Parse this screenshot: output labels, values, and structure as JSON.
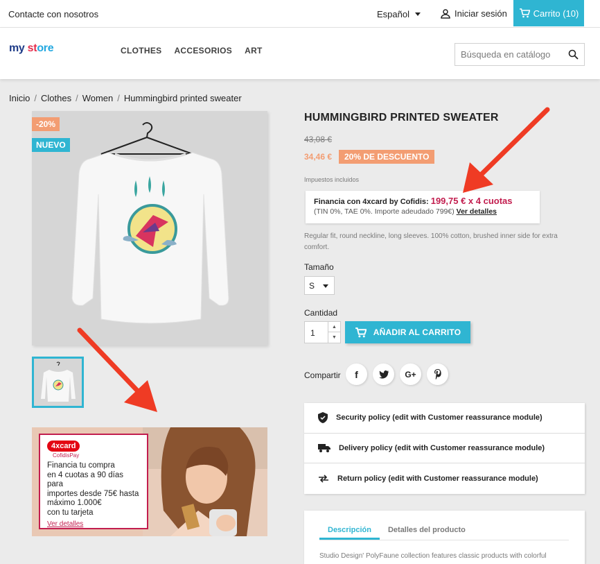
{
  "topbar": {
    "contact": "Contacte con nosotros",
    "language": "Español",
    "signin": "Iniciar sesión",
    "cart": "Carrito (10)"
  },
  "header": {
    "logo": {
      "part1": "my",
      "part2": " st",
      "part3": "ore"
    },
    "menu": [
      "CLOTHES",
      "ACCESORIOS",
      "ART"
    ],
    "search_placeholder": "Búsqueda en catálogo"
  },
  "breadcrumb": [
    "Inicio",
    "Clothes",
    "Women",
    "Hummingbird printed sweater"
  ],
  "product": {
    "flags": {
      "discount": "-20%",
      "new": "NUEVO"
    },
    "title": "HUMMINGBIRD PRINTED SWEATER",
    "old_price": "43,08 €",
    "price": "34,46 €",
    "discount_label": "20% DE DESCUENTO",
    "tax": "Impuestos incluidos",
    "financing": {
      "prefix": "Financia con 4xcard by Cofidis: ",
      "amount": "199,75 € x 4 cuotas",
      "detail": "(TIN 0%, TAE 0%. Importe adeudado 799€) ",
      "link": "Ver detalles"
    },
    "description": "Regular fit, round neckline, long sleeves. 100% cotton, brushed inner side for extra comfort.",
    "size_label": "Tamaño",
    "size_value": "S",
    "quantity_label": "Cantidad",
    "quantity_value": "1",
    "add_to_cart": "AÑADIR AL CARRITO",
    "share_label": "Compartir"
  },
  "banner": {
    "badge": "4xcard",
    "brand": "CofidisPay",
    "text_lines": [
      "Financia tu compra",
      "en 4 cuotas a 90 días para",
      "importes desde 75€ hasta",
      "máximo 1.000€",
      "con tu tarjeta"
    ],
    "link": "Ver detalles"
  },
  "reassurance": [
    {
      "icon": "shield-icon",
      "label": "Security policy (edit with Customer reassurance module)"
    },
    {
      "icon": "truck-icon",
      "label": "Delivery policy (edit with Customer reassurance module)"
    },
    {
      "icon": "swap-arrows-icon",
      "label": "Return policy (edit with Customer reassurance module)"
    }
  ],
  "tabs": {
    "items": [
      "Descripción",
      "Detalles del producto"
    ],
    "text": "Studio Design' PolyFaune collection features classic products with colorful"
  },
  "colors": {
    "accent": "#2fb5d2",
    "discount": "#f39d72",
    "cofidis": "#c21d4e",
    "arrow": "#ef3b24"
  }
}
